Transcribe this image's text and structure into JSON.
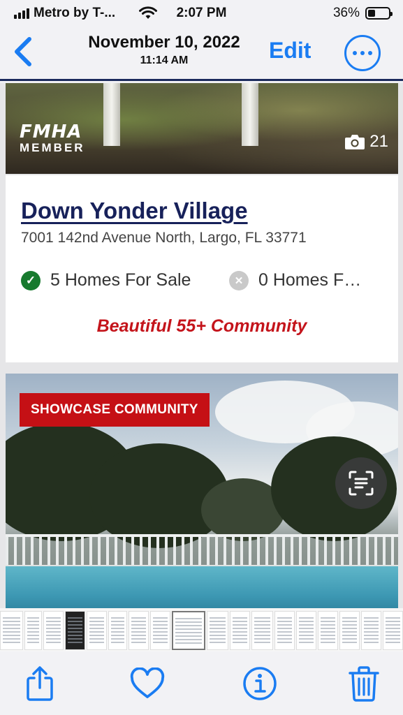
{
  "status_bar": {
    "carrier": "Metro by T-...",
    "time": "2:07 PM",
    "battery": "36%"
  },
  "nav": {
    "date": "November 10, 2022",
    "time": "11:14 AM",
    "edit_label": "Edit"
  },
  "listing": {
    "badge_main": "FMHA",
    "badge_sub": "MEMBER",
    "photo_count": "21",
    "title": "Down Yonder Village",
    "address": "7001 142nd Avenue North, Largo, FL 33771",
    "for_sale": "5 Homes For Sale",
    "for_rent": "0 Homes F…",
    "tagline": "Beautiful 55+ Community"
  },
  "showcase_label": "SHOWCASE COMMUNITY",
  "colors": {
    "accent": "#1a7cf2",
    "title": "#17215a",
    "tagline": "#c4141b",
    "showcase_bg": "#c51015",
    "check": "#177a2e"
  },
  "toolbar": {
    "icons": [
      "share-icon",
      "heart-icon",
      "info-icon",
      "trash-icon"
    ]
  }
}
